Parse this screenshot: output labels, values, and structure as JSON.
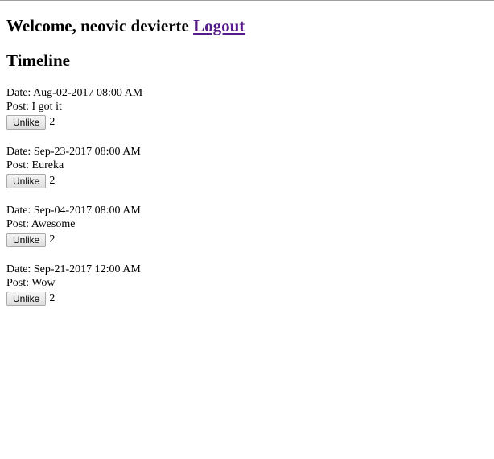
{
  "header": {
    "welcome_text": "Welcome, neovic devierte",
    "logout_label": "Logout"
  },
  "timeline": {
    "title": "Timeline",
    "date_prefix": "Date:",
    "post_prefix": "Post:",
    "unlike_label": "Unlike",
    "posts": [
      {
        "date": "Aug-02-2017 08:00 AM",
        "text": "I got it",
        "likes": "2"
      },
      {
        "date": "Sep-23-2017 08:00 AM",
        "text": "Eureka",
        "likes": "2"
      },
      {
        "date": "Sep-04-2017 08:00 AM",
        "text": "Awesome",
        "likes": "2"
      },
      {
        "date": "Sep-21-2017 12:00 AM",
        "text": "Wow",
        "likes": "2"
      }
    ]
  },
  "colors": {
    "link_visited": "#551a8b",
    "top_border": "#a0a0a0"
  }
}
